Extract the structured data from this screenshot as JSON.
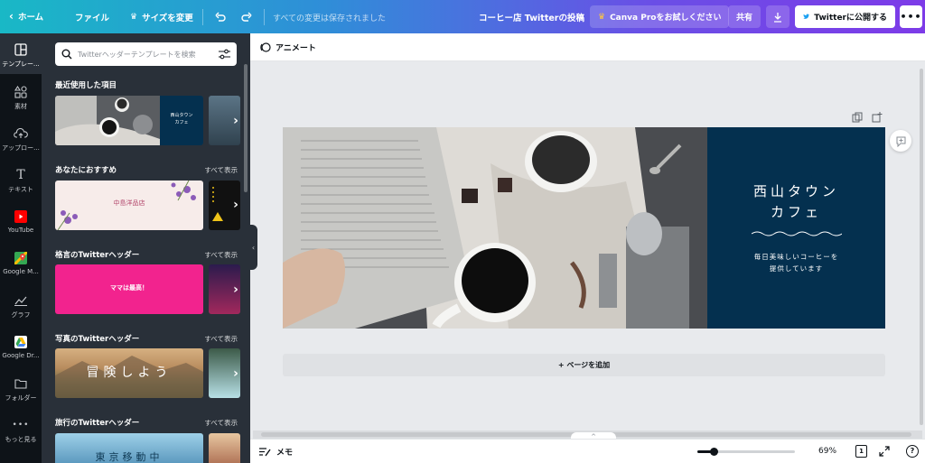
{
  "topbar": {
    "home_label": "ホーム",
    "file_label": "ファイル",
    "resize_label": "サイズを変更",
    "save_status": "すべての変更は保存されました",
    "doc_title": "コーヒー店 Twitterの投稿",
    "canva_pro_label": "Canva Proをお試しください",
    "share_label": "共有",
    "publish_label": "Twitterに公開する",
    "more_icon": "ellipsis-icon"
  },
  "sidebar": {
    "items": [
      {
        "label": "テンプレー...",
        "icon": "template-icon"
      },
      {
        "label": "素材",
        "icon": "elements-icon"
      },
      {
        "label": "アップロー...",
        "icon": "upload-cloud-icon"
      },
      {
        "label": "テキスト",
        "icon": "text-icon"
      },
      {
        "label": "YouTube",
        "icon": "youtube-icon"
      },
      {
        "label": "Google M...",
        "icon": "google-maps-icon"
      },
      {
        "label": "グラフ",
        "icon": "chart-icon"
      },
      {
        "label": "Google Dr...",
        "icon": "google-drive-icon"
      },
      {
        "label": "フォルダー",
        "icon": "folder-icon"
      },
      {
        "label": "もっと見る",
        "icon": "more-dots-icon"
      }
    ]
  },
  "panel": {
    "search_placeholder": "Twitterヘッダーテンプレートを検索",
    "show_all": "すべて表示",
    "sections": [
      {
        "title": "最近使用した項目"
      },
      {
        "title": "あなたにおすすめ"
      },
      {
        "title": "格言のTwitterヘッダー"
      },
      {
        "title": "写真のTwitterヘッダー"
      },
      {
        "title": "旅行のTwitterヘッダー"
      }
    ],
    "thumb_texts": {
      "recent_cafe_title": "西山タウン\nカフェ",
      "recommend_shop": "中島洋品店",
      "quote_text": "ママは最高！",
      "photo_text": "冒険しよう",
      "travel_text": "東京移動中"
    }
  },
  "canvas": {
    "animate_label": "アニメート",
    "add_page_label": "+ ページを追加",
    "design": {
      "title": "西山タウン\nカフェ",
      "subtitle": "毎日美味しいコーヒーを\n提供しています"
    }
  },
  "bottombar": {
    "memo_label": "メモ",
    "zoom_percent": "69%",
    "page_number": "1",
    "help_label": "?",
    "zoom_level": 0.17
  },
  "colors": {
    "navy": "#04304f",
    "rail": "#0e1318",
    "panel": "#293039",
    "publish_blue": "#1da1f2"
  }
}
